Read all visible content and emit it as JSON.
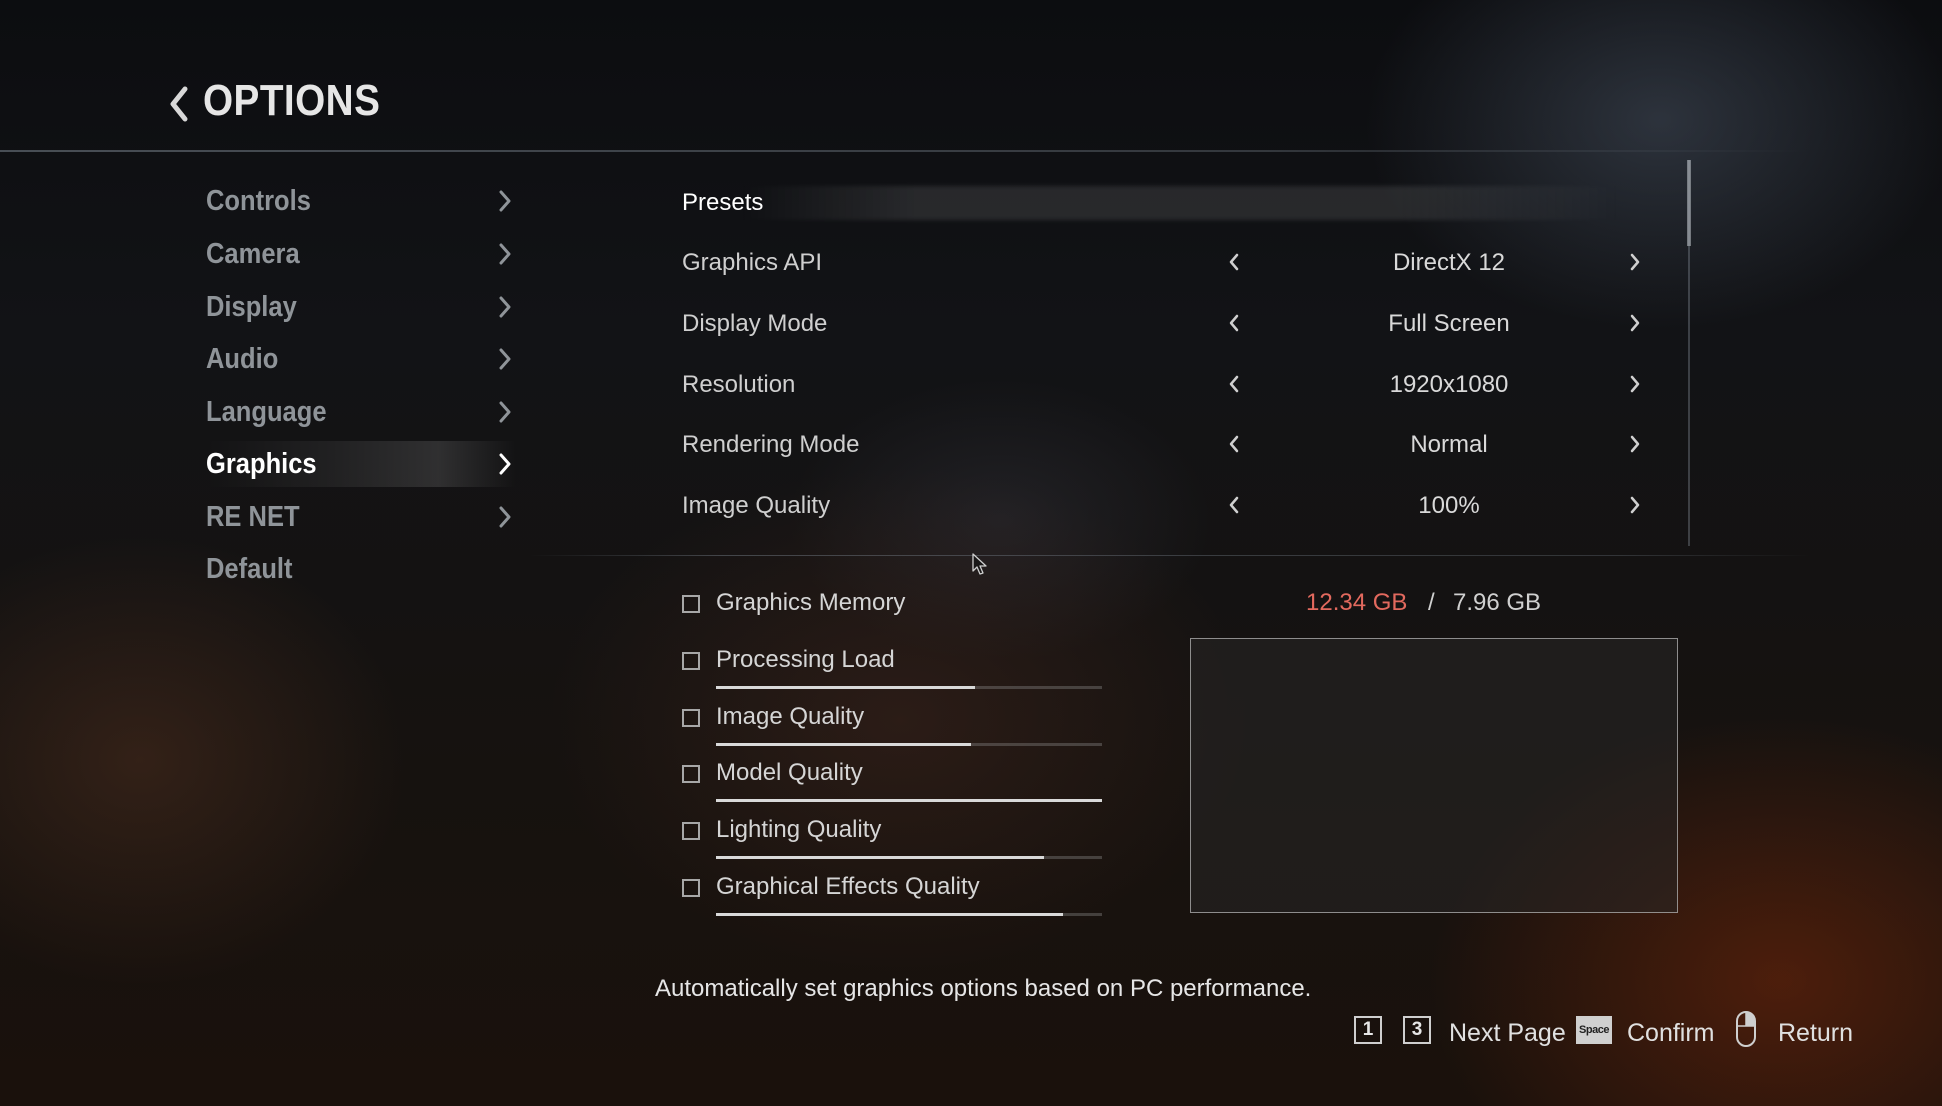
{
  "header": {
    "title": "OPTIONS",
    "back_icon": "chevron-left-icon"
  },
  "sidebar": {
    "items": [
      {
        "label": "Controls",
        "has_arrow": true
      },
      {
        "label": "Camera",
        "has_arrow": true
      },
      {
        "label": "Display",
        "has_arrow": true
      },
      {
        "label": "Audio",
        "has_arrow": true
      },
      {
        "label": "Language",
        "has_arrow": true
      },
      {
        "label": "Graphics",
        "has_arrow": true,
        "active": true
      },
      {
        "label": "RE NET",
        "has_arrow": true
      },
      {
        "label": "Default",
        "has_arrow": false
      }
    ]
  },
  "settings": {
    "presets_label": "Presets",
    "rows": [
      {
        "label": "Graphics API",
        "value": "DirectX 12"
      },
      {
        "label": "Display Mode",
        "value": "Full Screen"
      },
      {
        "label": "Resolution",
        "value": "1920x1080"
      },
      {
        "label": "Rendering Mode",
        "value": "Normal"
      },
      {
        "label": "Image Quality",
        "value": "100%"
      }
    ]
  },
  "load_meters": {
    "graphics_memory": {
      "label": "Graphics Memory",
      "used": "12.34 GB",
      "separator": "/",
      "total": "7.96 GB"
    },
    "meters": [
      {
        "label": "Processing Load",
        "level": 0.67
      },
      {
        "label": "Image Quality",
        "level": 0.66
      },
      {
        "label": "Model Quality",
        "level": 1.0
      },
      {
        "label": "Lighting Quality",
        "level": 0.85
      },
      {
        "label": "Graphical Effects Quality",
        "level": 0.9
      }
    ]
  },
  "description": "Automatically set graphics options based on PC performance.",
  "footer": {
    "key_1": "1",
    "key_3": "3",
    "next_page": "Next Page",
    "space_key": "Space",
    "confirm": "Confirm",
    "return": "Return"
  },
  "colors": {
    "memory_over": "#e2695e",
    "active_text": "#ffffff",
    "inactive_text": "#8f9499"
  }
}
